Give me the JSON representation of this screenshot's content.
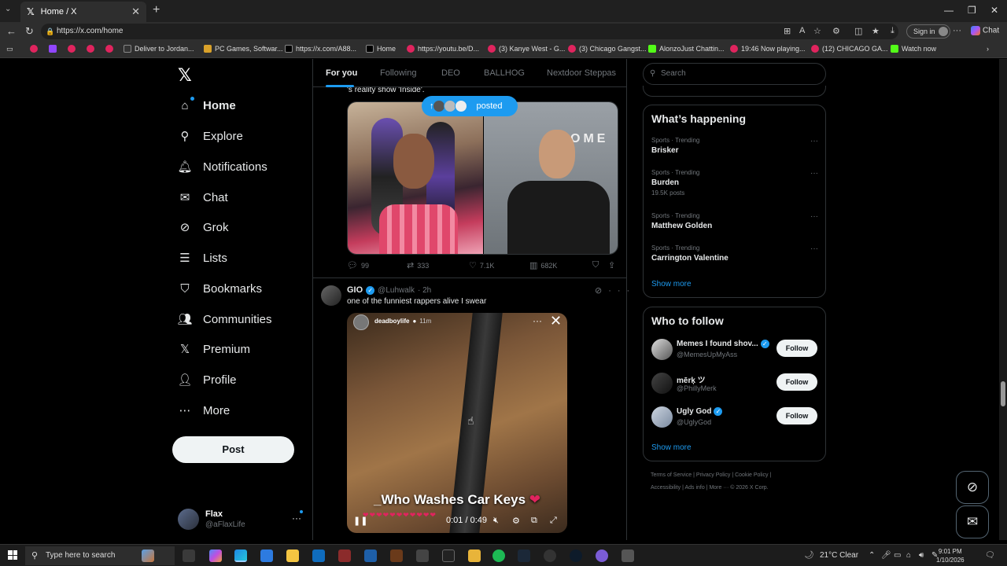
{
  "browser": {
    "tab_title": "Home / X",
    "tab_close": "✕",
    "new_tab": "+",
    "url": "https://x.com/home",
    "signin": "Sign in",
    "chat": "Chat",
    "bookmarks": [
      {
        "label": "",
        "icon": "youtube-icon"
      },
      {
        "label": "",
        "icon": "twitch-icon"
      },
      {
        "label": "",
        "icon": "youtube-icon"
      },
      {
        "label": "",
        "icon": "youtube-icon"
      },
      {
        "label": "",
        "icon": "youtube-icon"
      },
      {
        "label": "Deliver to Jordan...",
        "icon": "amazon-icon"
      },
      {
        "label": "PC Games, Softwar...",
        "icon": "pcgames-icon"
      },
      {
        "label": "https://x.com/A88...",
        "icon": "x-icon"
      },
      {
        "label": "Home",
        "icon": "x-icon"
      },
      {
        "label": "https://youtu.be/D...",
        "icon": "youtube-icon"
      },
      {
        "label": "(3) Kanye West - G...",
        "icon": "youtube-icon"
      },
      {
        "label": "(3) Chicago Gangst...",
        "icon": "youtube-icon"
      },
      {
        "label": "AlonzoJust Chattin...",
        "icon": "kick-icon"
      },
      {
        "label": "19:46 Now playing...",
        "icon": "youtube-icon"
      },
      {
        "label": "(12) CHICAGO GA...",
        "icon": "youtube-icon"
      },
      {
        "label": "Watch now",
        "icon": "kick-icon"
      }
    ]
  },
  "sidebar": {
    "items": [
      {
        "label": "Home",
        "icon": "home-icon"
      },
      {
        "label": "Explore",
        "icon": "search-icon"
      },
      {
        "label": "Notifications",
        "icon": "bell-icon"
      },
      {
        "label": "Chat",
        "icon": "mail-icon"
      },
      {
        "label": "Grok",
        "icon": "grok-icon"
      },
      {
        "label": "Lists",
        "icon": "list-icon"
      },
      {
        "label": "Bookmarks",
        "icon": "bookmark-icon"
      },
      {
        "label": "Communities",
        "icon": "people-icon"
      },
      {
        "label": "Premium",
        "icon": "x-icon"
      },
      {
        "label": "Profile",
        "icon": "person-icon"
      },
      {
        "label": "More",
        "icon": "more-circle-icon"
      }
    ],
    "post_button": "Post",
    "profile": {
      "name": "Flax",
      "handle": "@aFlaxLife"
    }
  },
  "feed": {
    "tabs": [
      "For you",
      "Following",
      "DEO",
      "BALLHOG",
      "Nextdoor Steppas"
    ],
    "fragment_text": "'s reality show 'Inside'.",
    "posted_pill": "posted",
    "post1_stats": {
      "replies": "99",
      "reposts": "333",
      "likes": "7.1K",
      "views": "682K"
    },
    "post2": {
      "name": "GIO",
      "handle": "@Luhwalk",
      "time": "· 2h",
      "text": "one of the funniest rappers alive I swear",
      "story_name": "deadboylife",
      "story_time": "11m",
      "caption": "_Who Washes Car Keys",
      "video_time": "0:01 / 0:49"
    }
  },
  "right": {
    "search_placeholder": "Search",
    "whats_happening": "What’s happening",
    "trends": [
      {
        "category": "Sports · Trending",
        "name": "Brisker",
        "posts": ""
      },
      {
        "category": "Sports · Trending",
        "name": "Burden",
        "posts": "19.5K posts"
      },
      {
        "category": "Sports · Trending",
        "name": "Matthew Golden",
        "posts": ""
      },
      {
        "category": "Sports · Trending",
        "name": "Carrington Valentine",
        "posts": ""
      }
    ],
    "show_more": "Show more",
    "who_to_follow": "Who to follow",
    "follow_suggestions": [
      {
        "name": "Memes I found shov...",
        "handle": "@MemesUpMyAss",
        "verified": true,
        "button": "Follow"
      },
      {
        "name": "mērķ ツ",
        "handle": "@PhillyMerk",
        "verified": false,
        "button": "Follow"
      },
      {
        "name": "Ugly God",
        "handle": "@UglyGod",
        "verified": true,
        "button": "Follow"
      }
    ],
    "footer_line1": "Terms of Service  |   Privacy Policy  |   Cookie Policy  |",
    "footer_line2": "Accessibility  |   Ads info  |   More ···   © 2026 X Corp."
  },
  "taskbar": {
    "search_placeholder": "Type here to search",
    "weather": "21°C  Clear",
    "time": "9:01 PM",
    "date": "1/10/2026"
  },
  "colors": {
    "accent": "#1d9bf0",
    "background": "#000000",
    "border": "#2f3336",
    "muted": "#71767b"
  }
}
